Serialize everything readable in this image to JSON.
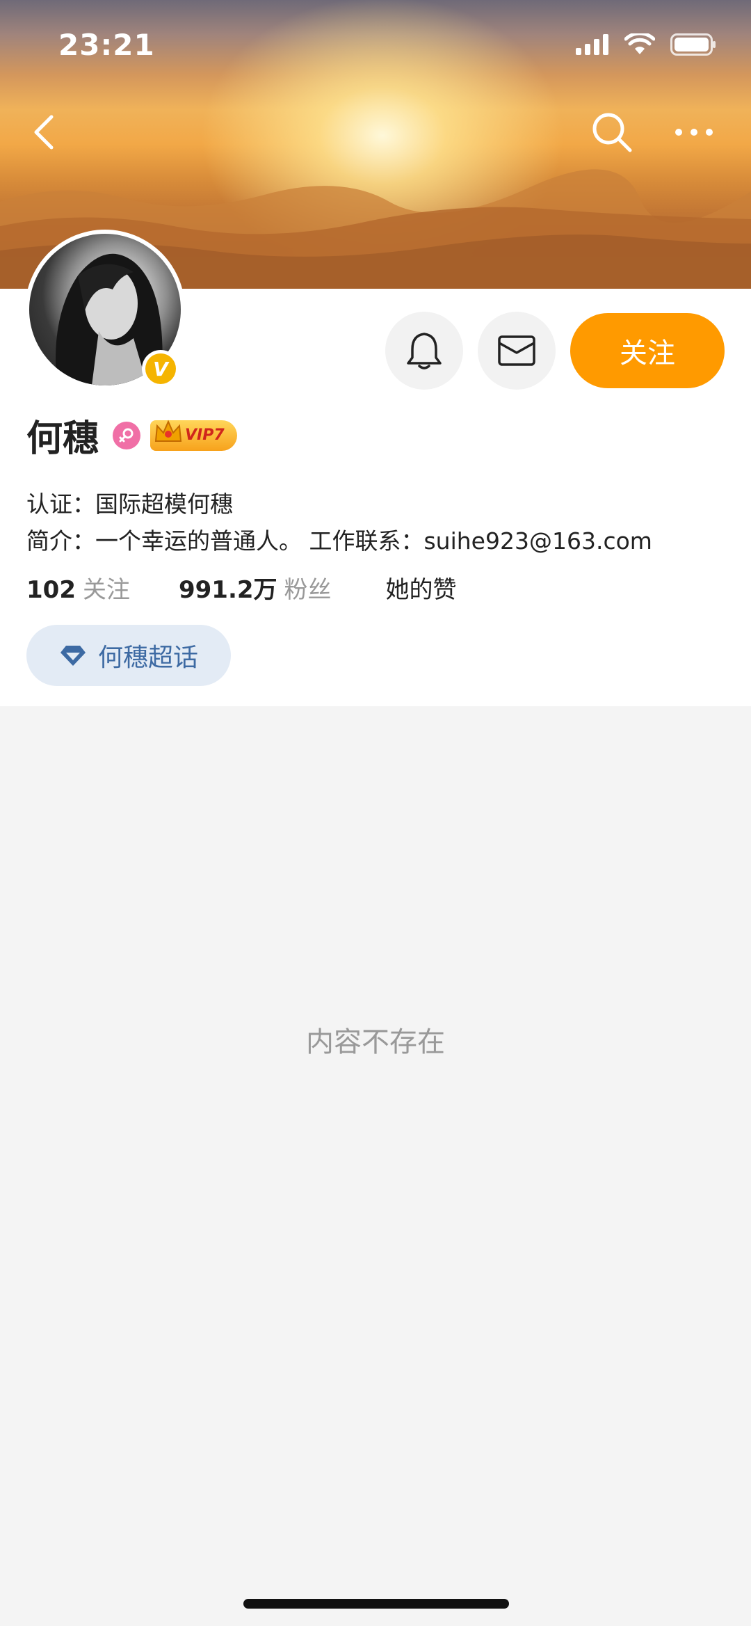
{
  "status_bar": {
    "time": "23:21"
  },
  "header": {
    "back_icon": "chevron-left-icon",
    "search_icon": "search-icon",
    "more_icon": "more-horizontal-icon"
  },
  "profile": {
    "name": "何穗",
    "gender": "female",
    "verified": true,
    "vip_label": "VIP7",
    "verification": "认证：国际超模何穗",
    "bio": "简介：一个幸运的普通人。 工作联系：suihe923@163.com",
    "stats": {
      "following_count": "102",
      "following_label": "关注",
      "followers_count": "991.2万",
      "followers_label": "粉丝",
      "likes_label": "她的赞"
    },
    "supertopic_label": "何穗超话"
  },
  "actions": {
    "notify_icon": "bell-icon",
    "message_icon": "mail-icon",
    "follow_label": "关注"
  },
  "content": {
    "empty_text": "内容不存在"
  },
  "colors": {
    "accent": "#ff9a00",
    "verified_badge": "#f5b400",
    "supertopic_bg": "#e3ebf5",
    "supertopic_text": "#3d6aa3"
  }
}
